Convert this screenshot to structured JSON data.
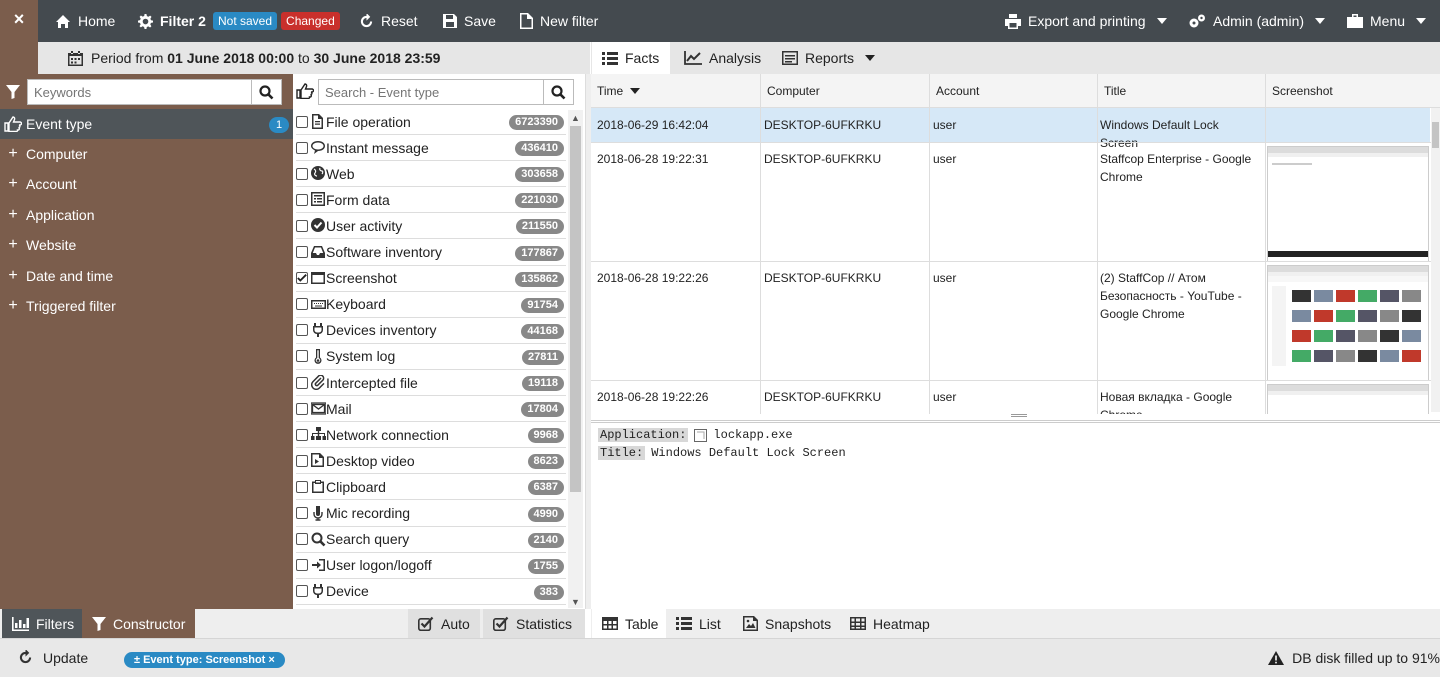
{
  "topbar": {
    "close": "×",
    "home": "Home",
    "filter_name": "Filter 2",
    "badge_not_saved": "Not saved",
    "badge_changed": "Changed",
    "reset": "Reset",
    "save": "Save",
    "new_filter": "New filter",
    "export": "Export and printing",
    "user": "Admin (admin)",
    "menu": "Menu",
    "colors": {
      "bar": "#444a4f",
      "brown": "#7b5d4c",
      "not_saved": "#2a8ac4",
      "changed": "#c9302c"
    }
  },
  "period": {
    "from_label": "Period from",
    "from": "01 June 2018 00:00",
    "to_label": "to",
    "to": "30 June 2018 23:59"
  },
  "filters": {
    "keywords_placeholder": "Keywords",
    "categories": [
      {
        "label": "Event type",
        "count": "1"
      },
      {
        "label": "Computer"
      },
      {
        "label": "Account"
      },
      {
        "label": "Application"
      },
      {
        "label": "Website"
      },
      {
        "label": "Date and time"
      },
      {
        "label": "Triggered filter"
      }
    ]
  },
  "event_types": {
    "search_placeholder": "Search - Event type",
    "items": [
      {
        "label": "File operation",
        "count": "6723390",
        "checked": false,
        "icon": "file-icon"
      },
      {
        "label": "Instant message",
        "count": "436410",
        "checked": false,
        "icon": "chat-icon"
      },
      {
        "label": "Web",
        "count": "303658",
        "checked": false,
        "icon": "globe-icon"
      },
      {
        "label": "Form data",
        "count": "221030",
        "checked": false,
        "icon": "form-icon"
      },
      {
        "label": "User activity",
        "count": "211550",
        "checked": false,
        "icon": "check-circle-icon"
      },
      {
        "label": "Software inventory",
        "count": "177867",
        "checked": false,
        "icon": "inbox-icon"
      },
      {
        "label": "Screenshot",
        "count": "135862",
        "checked": true,
        "icon": "window-icon"
      },
      {
        "label": "Keyboard",
        "count": "91754",
        "checked": false,
        "icon": "keyboard-icon"
      },
      {
        "label": "Devices inventory",
        "count": "44168",
        "checked": false,
        "icon": "plug-icon"
      },
      {
        "label": "System log",
        "count": "27811",
        "checked": false,
        "icon": "thermometer-icon"
      },
      {
        "label": "Intercepted file",
        "count": "19118",
        "checked": false,
        "icon": "paperclip-icon"
      },
      {
        "label": "Mail",
        "count": "17804",
        "checked": false,
        "icon": "envelope-icon"
      },
      {
        "label": "Network connection",
        "count": "9968",
        "checked": false,
        "icon": "network-icon"
      },
      {
        "label": "Desktop video",
        "count": "8623",
        "checked": false,
        "icon": "video-icon"
      },
      {
        "label": "Clipboard",
        "count": "6387",
        "checked": false,
        "icon": "clipboard-icon"
      },
      {
        "label": "Mic recording",
        "count": "4990",
        "checked": false,
        "icon": "microphone-icon"
      },
      {
        "label": "Search query",
        "count": "2140",
        "checked": false,
        "icon": "search-icon"
      },
      {
        "label": "User logon/logoff",
        "count": "1755",
        "checked": false,
        "icon": "sign-in-icon"
      },
      {
        "label": "Device",
        "count": "383",
        "checked": false,
        "icon": "plug-icon"
      }
    ]
  },
  "view_tabs": {
    "facts": "Facts",
    "analysis": "Analysis",
    "reports": "Reports"
  },
  "grid": {
    "columns": [
      "Time",
      "Computer",
      "Account",
      "Title",
      "Screenshot"
    ],
    "rows": [
      {
        "time": "2018-06-29 16:42:04",
        "computer": "DESKTOP-6UFKRKU",
        "account": "user",
        "title": "Windows Default Lock Screen"
      },
      {
        "time": "2018-06-28 19:22:31",
        "computer": "DESKTOP-6UFKRKU",
        "account": "user",
        "title": "Staffcop Enterprise - Google Chrome"
      },
      {
        "time": "2018-06-28 19:22:26",
        "computer": "DESKTOP-6UFKRKU",
        "account": "user",
        "title": "(2) StaffCop // Атом Безопасность - YouTube - Google Chrome"
      },
      {
        "time": "2018-06-28 19:22:26",
        "computer": "DESKTOP-6UFKRKU",
        "account": "user",
        "title": "Новая вкладка - Google Chrome"
      }
    ]
  },
  "detail": {
    "application_label": "Application:",
    "application_value": "lockapp.exe",
    "title_label": "Title:",
    "title_value": "Windows Default Lock Screen"
  },
  "bottom": {
    "filters": "Filters",
    "constructor": "Constructor",
    "auto": "Auto",
    "statistics": "Statistics",
    "table": "Table",
    "list": "List",
    "snapshots": "Snapshots",
    "heatmap": "Heatmap"
  },
  "status": {
    "update": "Update",
    "chip": "± Event type: Screenshot ×",
    "disk": "DB disk filled up to 91%"
  }
}
